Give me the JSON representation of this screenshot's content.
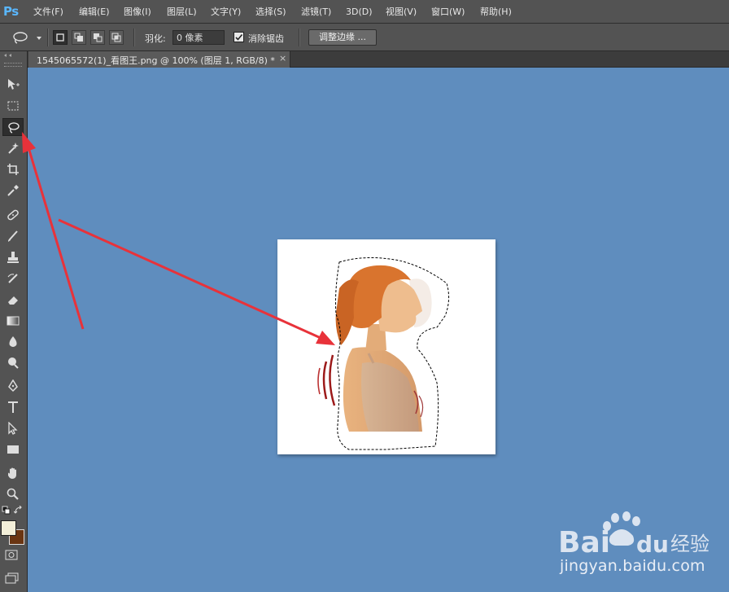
{
  "app": {
    "logo": "Ps"
  },
  "menu": [
    "文件(F)",
    "编辑(E)",
    "图像(I)",
    "图层(L)",
    "文字(Y)",
    "选择(S)",
    "滤镜(T)",
    "3D(D)",
    "视图(V)",
    "窗口(W)",
    "帮助(H)"
  ],
  "options": {
    "feather_label": "羽化:",
    "feather_value": "0 像素",
    "antialias_label": "消除锯齿",
    "antialias_checked": true,
    "refine_edge_label": "调整边缘 ..."
  },
  "document": {
    "tab_title": "1545065572(1)_看图王.png @ 100% (图层 1, RGB/8) *",
    "close_label": "×"
  },
  "tools": [
    "move-icon",
    "marquee-icon",
    "lasso-icon",
    "magic-wand-icon",
    "crop-icon",
    "eyedropper-icon",
    "healing-brush-icon",
    "brush-icon",
    "clone-stamp-icon",
    "history-brush-icon",
    "eraser-icon",
    "gradient-icon",
    "blur-icon",
    "dodge-icon",
    "pen-icon",
    "type-icon",
    "path-selection-icon",
    "rectangle-shape-icon",
    "hand-icon",
    "zoom-icon"
  ],
  "colors": {
    "foreground": "#f3efd9",
    "background": "#6a3512",
    "canvas_bg": "#5f8dbe",
    "annotation_arrow": "#e8323a"
  },
  "watermark": {
    "brand": "Bai du 经验",
    "url": "jingyan.baidu.com"
  }
}
